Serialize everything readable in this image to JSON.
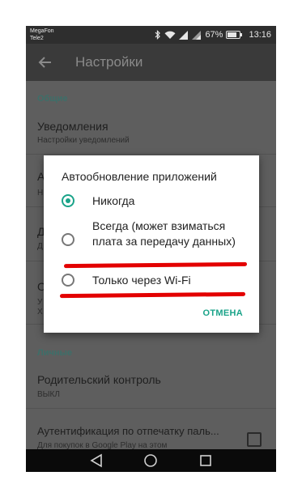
{
  "statusbar": {
    "carrier_1": "MegaFon",
    "carrier_2": "Tele2",
    "battery_percent": "67%",
    "time": "13:16"
  },
  "appbar": {
    "title": "Настройки"
  },
  "settings": {
    "section_general": "Общие",
    "notifications_title": "Уведомления",
    "notifications_sub": "Настройки уведомлений",
    "hidden_row_1_letter": "А",
    "hidden_row_1_sub_letter": "Н",
    "hidden_row_2_letter": "Д",
    "hidden_row_2_sub_letter": "Д",
    "hidden_row_3_letter": "О",
    "hidden_row_3_sub_letter": "У",
    "hidden_row_3_sub2_letter": "Х",
    "section_personal": "Личные",
    "parental_title": "Родительский контроль",
    "parental_sub": "ВЫКЛ",
    "fingerprint_title": "Аутентификация по отпечатку паль...",
    "fingerprint_sub": "Для покупок в Google Play на этом"
  },
  "dialog": {
    "title": "Автообновление приложений",
    "options": [
      {
        "label": "Никогда",
        "selected": true
      },
      {
        "label": "Всегда (может взиматься плата за передачу данных)",
        "selected": false
      },
      {
        "label": "Только через Wi-Fi",
        "selected": false
      }
    ],
    "cancel_label": "ОТМЕНА"
  },
  "colors": {
    "accent": "#1aa389",
    "highlight_underline": "#e30000"
  },
  "icons": [
    "back-arrow-icon",
    "bluetooth-icon",
    "wifi-icon",
    "signal-icon",
    "battery-icon",
    "nav-back-icon",
    "nav-home-icon",
    "nav-recents-icon"
  ]
}
